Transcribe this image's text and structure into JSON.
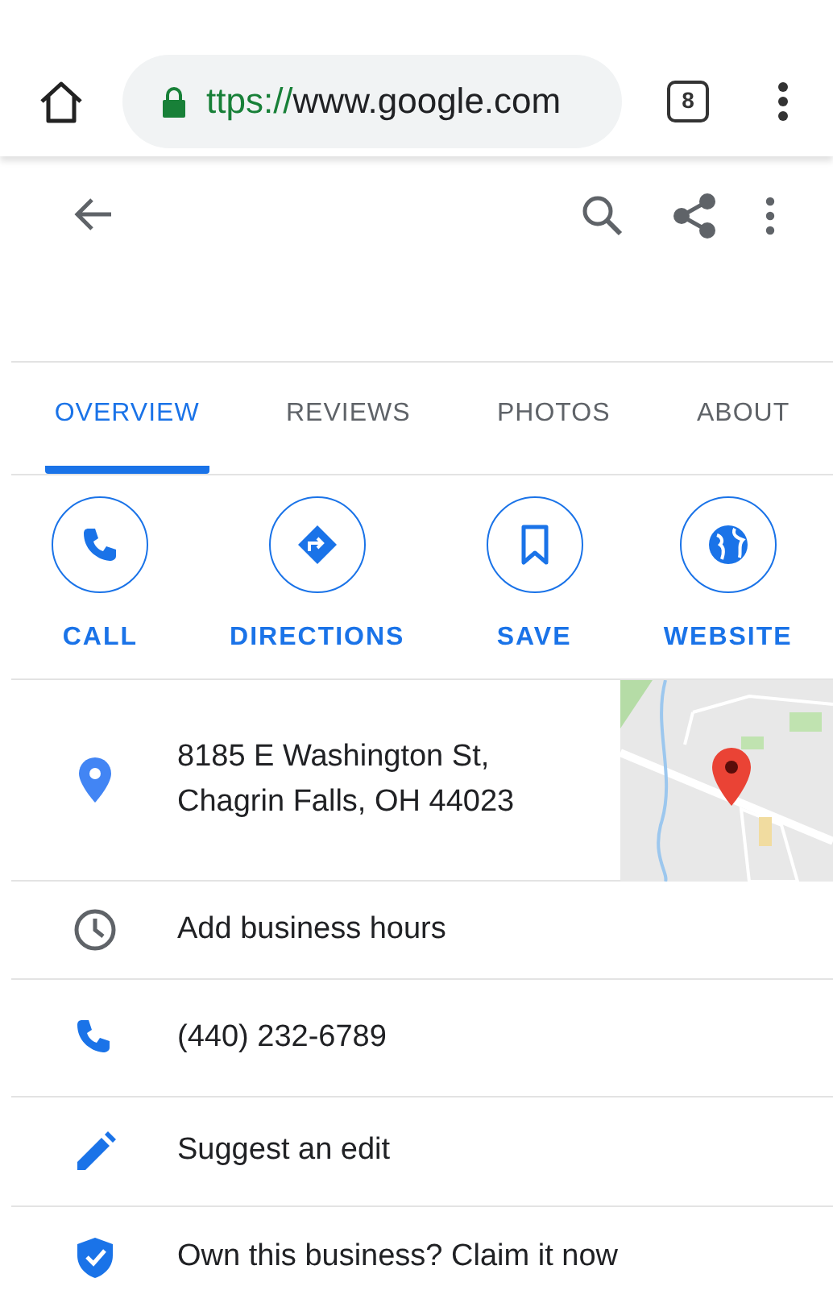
{
  "browser": {
    "url_scheme": "ttps://",
    "url_host": "www.google.com",
    "tab_count": "8"
  },
  "tabs": [
    {
      "label": "OVERVIEW",
      "selected": true
    },
    {
      "label": "REVIEWS",
      "selected": false
    },
    {
      "label": "PHOTOS",
      "selected": false
    },
    {
      "label": "ABOUT",
      "selected": false
    }
  ],
  "actions": [
    {
      "kind": "call",
      "label": "CALL"
    },
    {
      "kind": "directions",
      "label": "DIRECTIONS"
    },
    {
      "kind": "save",
      "label": "SAVE"
    },
    {
      "kind": "website",
      "label": "WEBSITE"
    }
  ],
  "address": {
    "lines": [
      "8185 E Washington St,",
      "Chagrin Falls, OH 44023"
    ]
  },
  "rows": [
    {
      "kind": "hours",
      "text": "Add business hours"
    },
    {
      "kind": "phone",
      "text": "(440) 232-6789"
    },
    {
      "kind": "edit",
      "text": "Suggest an edit"
    },
    {
      "kind": "claim",
      "text": "Own this business? Claim it now"
    }
  ]
}
